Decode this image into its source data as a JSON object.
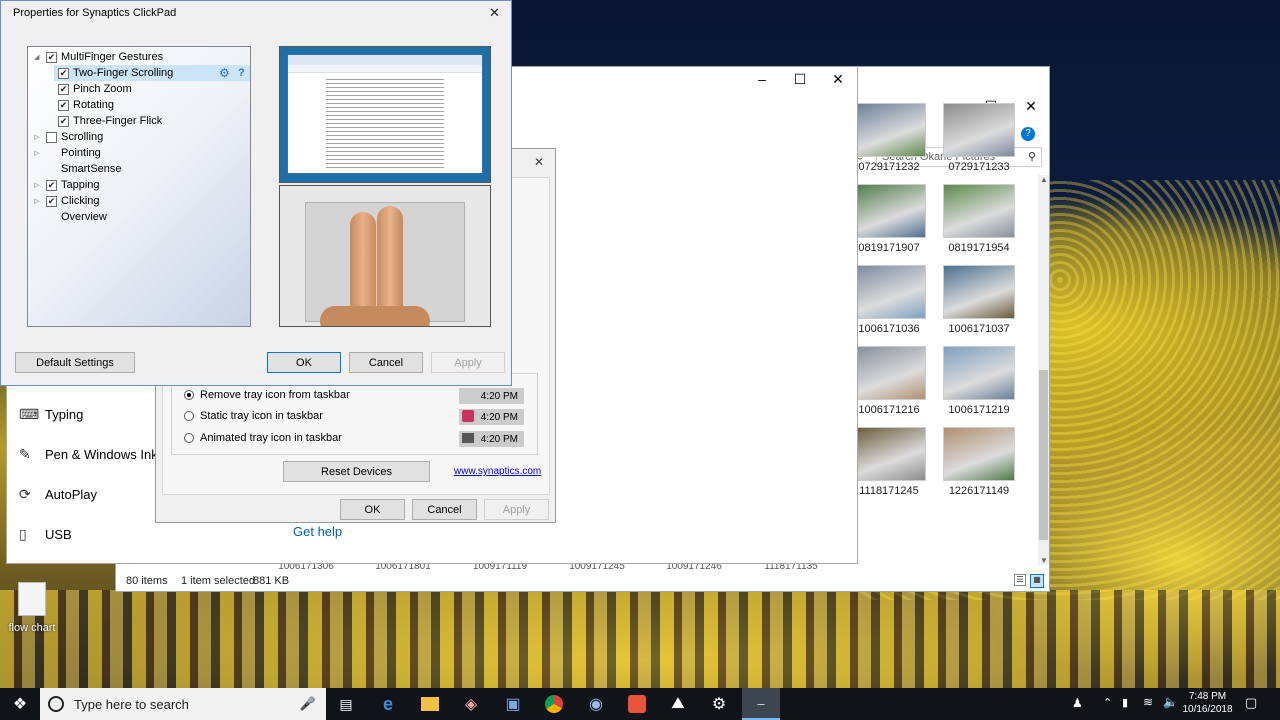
{
  "synaptics": {
    "title": "Properties for Synaptics ClickPad",
    "tree": [
      {
        "label": "MultiFinger Gestures",
        "checked": true,
        "has_checkbox": true,
        "expanded": true
      },
      {
        "label": "Two-Finger Scrolling",
        "checked": true,
        "has_checkbox": true,
        "selected": true
      },
      {
        "label": "Pinch Zoom",
        "checked": true,
        "has_checkbox": true
      },
      {
        "label": "Rotating",
        "checked": true,
        "has_checkbox": true
      },
      {
        "label": "Three-Finger Flick",
        "checked": true,
        "has_checkbox": true
      },
      {
        "label": "Scrolling",
        "checked": false,
        "has_checkbox": true
      },
      {
        "label": "Pointing",
        "has_checkbox": false
      },
      {
        "label": "SmartSense",
        "has_checkbox": false
      },
      {
        "label": "Tapping",
        "checked": true,
        "has_checkbox": true
      },
      {
        "label": "Clicking",
        "checked": true,
        "has_checkbox": true
      },
      {
        "label": "Overview",
        "has_checkbox": false
      }
    ],
    "default_settings_label": "Default Settings",
    "ok_label": "OK",
    "cancel_label": "Cancel",
    "apply_label": "Apply"
  },
  "mouse_props": {
    "options": [
      {
        "label": "Remove tray icon from taskbar",
        "selected": true,
        "time": "4:20 PM"
      },
      {
        "label": "Static tray icon in taskbar",
        "selected": false,
        "time": "4:20 PM"
      },
      {
        "label": "Animated tray icon in taskbar",
        "selected": false,
        "time": "4:20 PM"
      }
    ],
    "reset_devices_label": "Reset Devices",
    "link_text": "www.synaptics.com",
    "ok_label": "OK",
    "cancel_label": "Cancel",
    "apply_label": "Apply"
  },
  "settings": {
    "items": [
      {
        "label": "Typing",
        "icon": "keyboard-icon"
      },
      {
        "label": "Pen & Windows Ink",
        "icon": "pen-icon"
      },
      {
        "label": "AutoPlay",
        "icon": "autoplay-icon"
      },
      {
        "label": "USB",
        "icon": "usb-icon"
      }
    ],
    "get_help": "Get help"
  },
  "explorer": {
    "search_placeholder": "Search Okane Pictures",
    "photos": [
      {
        "name": "0729171232"
      },
      {
        "name": "0729171233"
      },
      {
        "name": "0819171907"
      },
      {
        "name": "0819171954"
      },
      {
        "name": "1006171036"
      },
      {
        "name": "1006171037"
      },
      {
        "name": "1006171216"
      },
      {
        "name": "1006171219"
      },
      {
        "name": "1118171245"
      },
      {
        "name": "1226171149"
      }
    ],
    "bottom_row": [
      "1006171306",
      "1006171801",
      "1009171119",
      "1009171245",
      "1009171246",
      "1118171135"
    ],
    "status_items": "80 items",
    "status_selected": "1 item selected",
    "status_size": "881 KB"
  },
  "desktop": {
    "icon_label": "flow chart"
  },
  "taskbar": {
    "search_placeholder": "Type here to search",
    "time": "7:48 PM",
    "date": "10/16/2018"
  },
  "colors": {
    "accent": "#0078d7",
    "selection": "#cce4f7",
    "taskbar": "#101418"
  }
}
